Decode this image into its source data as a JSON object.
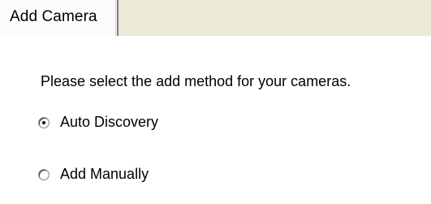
{
  "tab": {
    "label": "Add Camera"
  },
  "prompt": "Please select the add method for your cameras.",
  "options": [
    {
      "label": "Auto Discovery",
      "selected": true
    },
    {
      "label": "Add Manually",
      "selected": false
    }
  ]
}
